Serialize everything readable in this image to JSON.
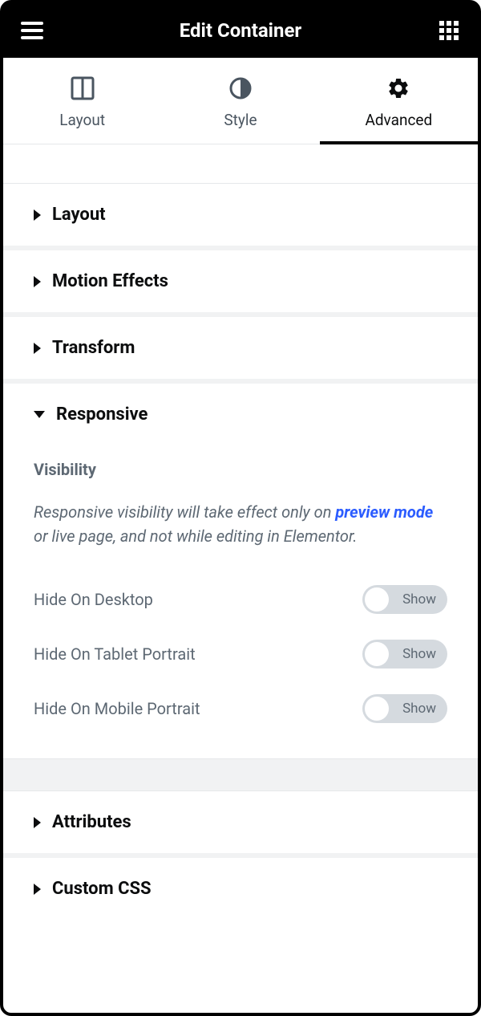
{
  "header": {
    "title": "Edit Container"
  },
  "tabs": [
    {
      "label": "Layout"
    },
    {
      "label": "Style"
    },
    {
      "label": "Advanced"
    }
  ],
  "sections": {
    "layout": {
      "title": "Layout"
    },
    "motion": {
      "title": "Motion Effects"
    },
    "transform": {
      "title": "Transform"
    },
    "responsive": {
      "title": "Responsive",
      "subheading": "Visibility",
      "note_pre": "Responsive visibility will take effect only on ",
      "note_link": "preview mode",
      "note_post": " or live page, and not while editing in Elementor.",
      "controls": [
        {
          "label": "Hide On Desktop",
          "toggle": "Show"
        },
        {
          "label": "Hide On Tablet Portrait",
          "toggle": "Show"
        },
        {
          "label": "Hide On Mobile Portrait",
          "toggle": "Show"
        }
      ]
    },
    "attributes": {
      "title": "Attributes"
    },
    "customcss": {
      "title": "Custom CSS"
    }
  }
}
